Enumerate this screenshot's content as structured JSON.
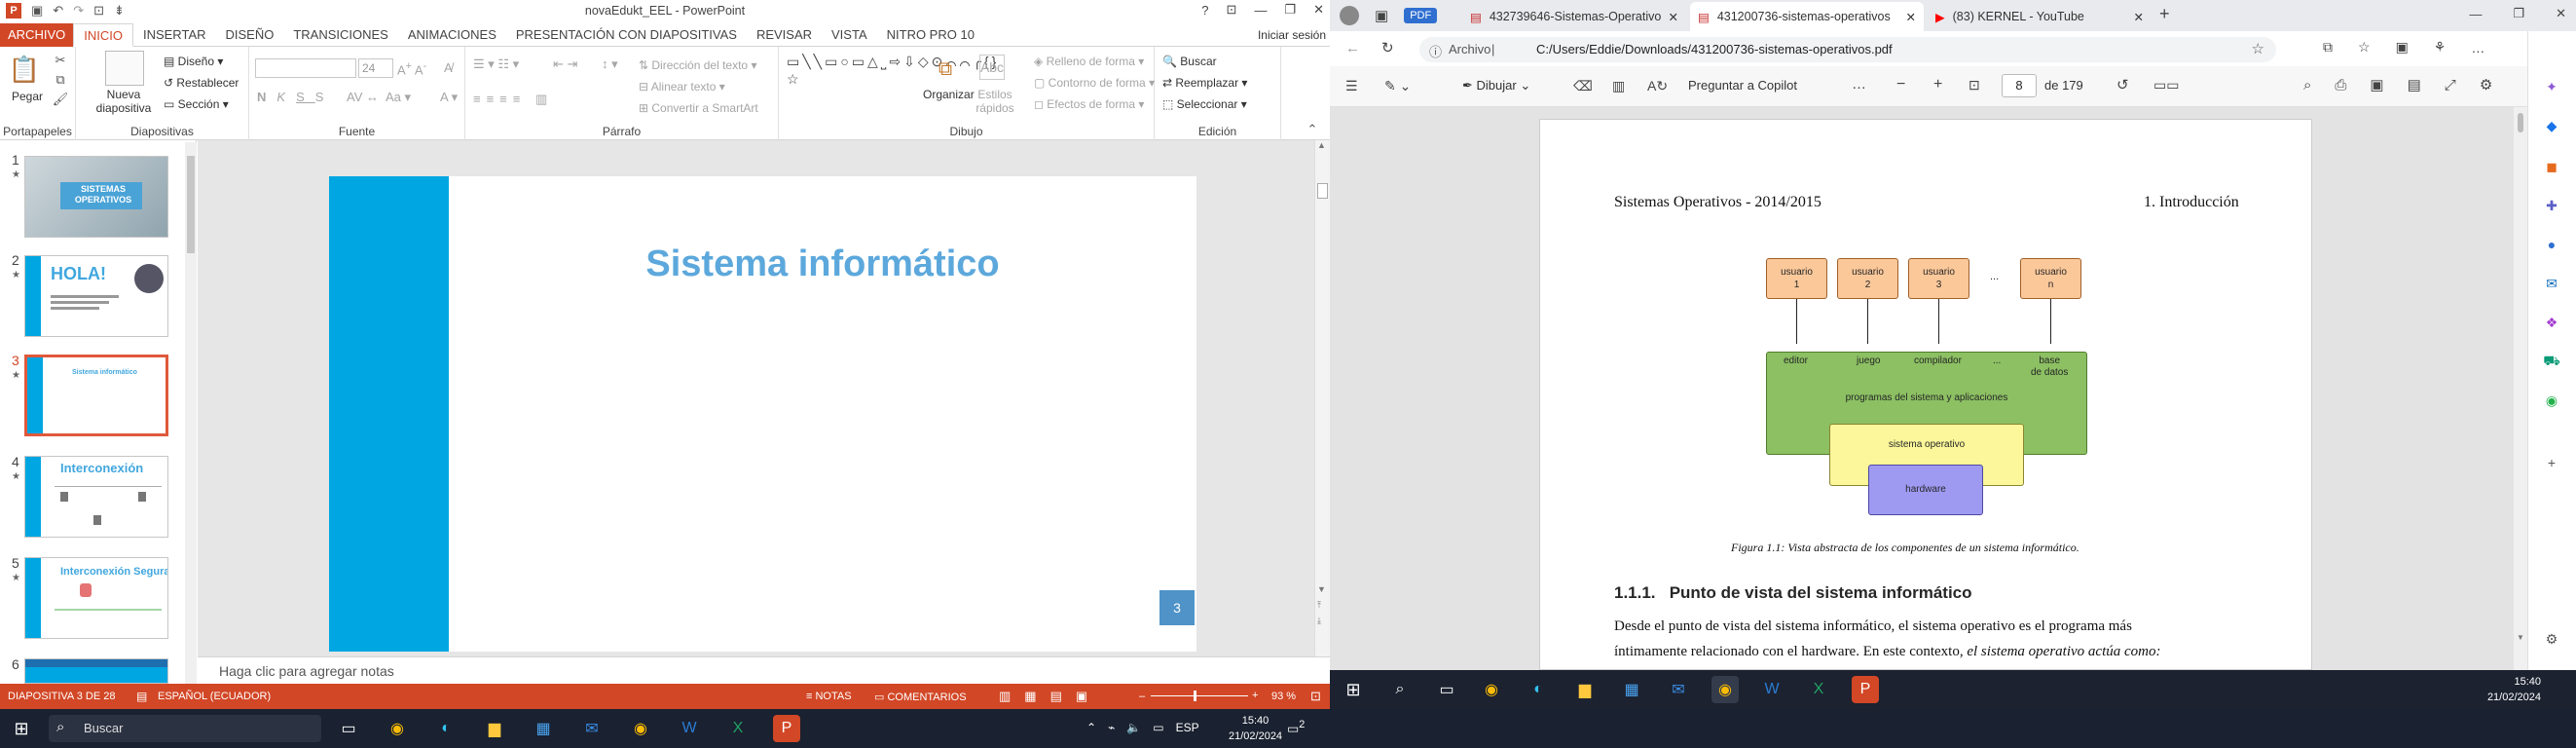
{
  "ppt": {
    "title": "novaEdukt_EEL - PowerPoint",
    "signin": "Iniciar sesión",
    "tabs": [
      "ARCHIVO",
      "INICIO",
      "INSERTAR",
      "DISEÑO",
      "TRANSICIONES",
      "ANIMACIONES",
      "PRESENTACIÓN CON DIAPOSITIVAS",
      "REVISAR",
      "VISTA",
      "NITRO PRO 10"
    ],
    "ribbon": {
      "pegar": "Pegar",
      "nueva_diapositiva": "Nueva diapositiva",
      "diseno": "Diseño",
      "restablecer": "Restablecer",
      "seccion": "Sección",
      "font_size": "24",
      "direccion_texto": "Dirección del texto",
      "alinear_texto": "Alinear texto",
      "convertir_smartart": "Convertir a SmartArt",
      "organizar": "Organizar",
      "estilos_rapidos": "Estilos rápidos",
      "relleno_forma": "Relleno de forma",
      "contorno_forma": "Contorno de forma",
      "efectos_forma": "Efectos de forma",
      "buscar": "Buscar",
      "reemplazar": "Reemplazar",
      "seleccionar": "Seleccionar",
      "groups": [
        "Portapapeles",
        "Diapositivas",
        "Fuente",
        "Párrafo",
        "Dibujo",
        "Edición"
      ]
    },
    "thumbs": [
      {
        "num": "1",
        "text": "SISTEMAS OPERATIVOS"
      },
      {
        "num": "2",
        "text": "HOLA!"
      },
      {
        "num": "3",
        "text": "Sistema informático"
      },
      {
        "num": "4",
        "text": "Interconexión"
      },
      {
        "num": "5",
        "text": "Interconexión Segura"
      },
      {
        "num": "6",
        "text": ""
      }
    ],
    "slide": {
      "title": "Sistema informático",
      "number": "3"
    },
    "notes_placeholder": "Haga clic para agregar notas",
    "status": {
      "slide_info": "DIAPOSITIVA 3 DE 28",
      "language": "ESPAÑOL (ECUADOR)",
      "notas": "NOTAS",
      "comentarios": "COMENTARIOS",
      "zoom": "93 %"
    }
  },
  "edge": {
    "tabs": [
      {
        "label": "432739646-Sistemas-Operativo"
      },
      {
        "label": "431200736-sistemas-operativos"
      },
      {
        "label": "(83) KERNEL - YouTube"
      }
    ],
    "address_prefix": "Archivo",
    "address": "C:/Users/Eddie/Downloads/431200736-sistemas-operativos.pdf",
    "pdf_toolbar": {
      "dibujar": "Dibujar",
      "copilot": "Preguntar a Copilot",
      "page": "8",
      "of_pages": "de 179"
    },
    "pdf": {
      "header_left": "Sistemas Operativos - 2014/2015",
      "header_right": "1. Introducción",
      "users": [
        "usuario\n1",
        "usuario\n2",
        "usuario\n3",
        "...",
        "usuario\nn"
      ],
      "apps": [
        "editor",
        "juego",
        "compilador",
        "...",
        "base\nde datos"
      ],
      "layer_apps": "programas del sistema y aplicaciones",
      "layer_os": "sistema operativo",
      "layer_hw": "hardware",
      "caption": "Figura 1.1: Vista abstracta de los componentes de un sistema informático.",
      "section": "1.1.1.   Punto de vista del sistema informático",
      "para1": "Desde el punto de vista del sistema informático, el sistema operativo es el programa más",
      "para2": "íntimamente relacionado con el hardware. En este contexto,",
      "para2_em": "el sistema operativo actúa como:"
    }
  },
  "taskbar_right": {
    "time": "15:40",
    "date": "21/02/2024"
  },
  "taskbar_bottom": {
    "search": "Buscar",
    "lang": "ESP",
    "time": "15:40",
    "date": "21/02/2024",
    "notif": "2"
  }
}
